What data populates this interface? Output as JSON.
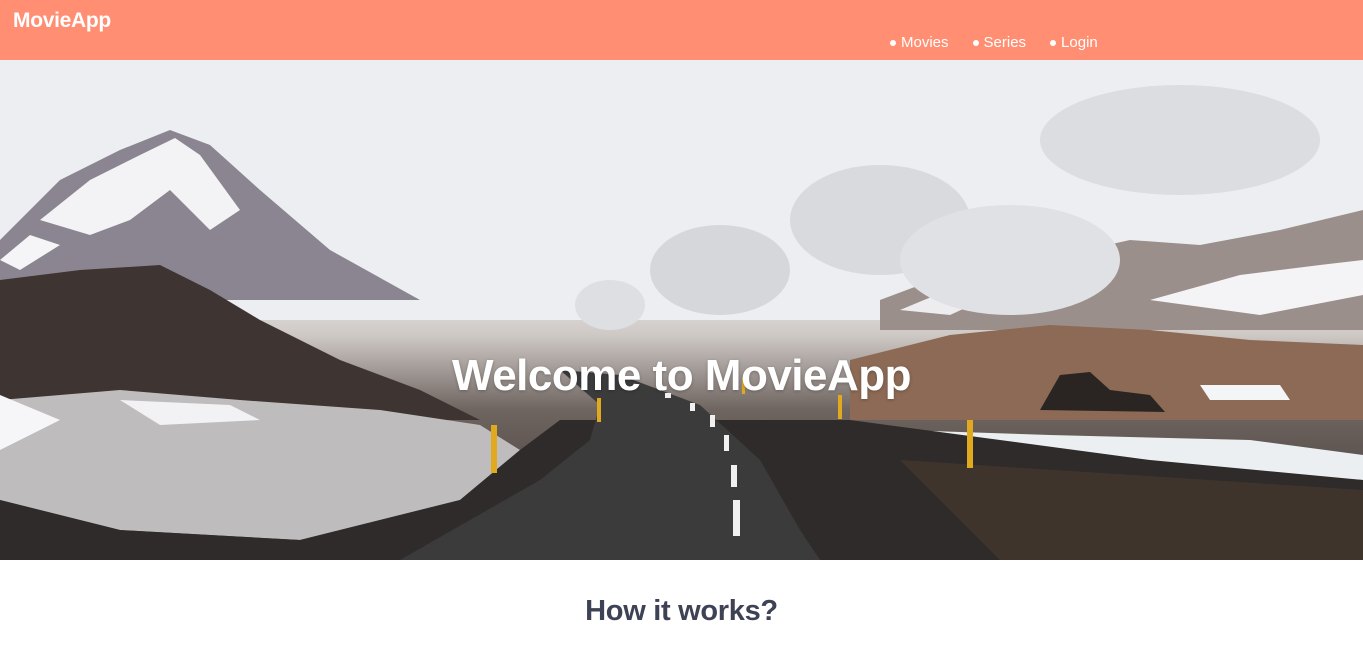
{
  "header": {
    "brand": "MovieApp",
    "nav": [
      {
        "label": "Movies"
      },
      {
        "label": "Series"
      },
      {
        "label": "Login"
      }
    ]
  },
  "hero": {
    "title": "Welcome to MovieApp",
    "image": "icelandic-road-landscape"
  },
  "section": {
    "title": "How it works?"
  },
  "colors": {
    "header_bg": "#ff8e72",
    "heading": "#3e4255"
  }
}
